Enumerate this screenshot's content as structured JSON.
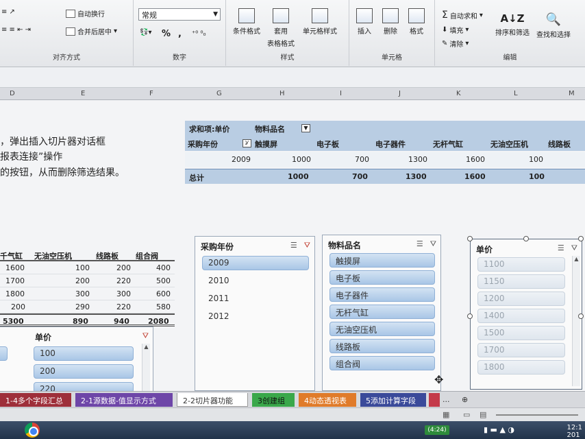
{
  "ribbon": {
    "alignment_group": {
      "label": "对齐方式",
      "wrap": "自动换行",
      "merge": "合并后居中"
    },
    "number_group": {
      "label": "数字",
      "format": "常规",
      "percent": "%",
      "comma": ","
    },
    "styles_group": {
      "label": "样式",
      "conditional": "条件格式",
      "table_format_1": "套用",
      "table_format_2": "表格格式",
      "cell_styles": "单元格样式"
    },
    "cells_group": {
      "label": "单元格",
      "insert": "插入",
      "delete": "删除",
      "format": "格式"
    },
    "editing_group": {
      "label": "编辑",
      "autosum": "自动求和",
      "fill": "填充",
      "clear": "清除",
      "sort": "排序和筛选",
      "find": "查找和选择"
    }
  },
  "columns": [
    "D",
    "E",
    "F",
    "G",
    "H",
    "I",
    "J",
    "K",
    "L",
    "M"
  ],
  "notes": [
    "，弹出插入切片器对话框",
    "报表连接”操作",
    "的按钮，从而删除筛选结果。"
  ],
  "pivot": {
    "header_left": "求和项:单价",
    "header_field": "物料品名",
    "row_field": "采购年份",
    "columns": [
      "触摸屏",
      "电子板",
      "电子器件",
      "无杆气缸",
      "无油空压机",
      "线路板"
    ],
    "year": "2009",
    "values": [
      "1000",
      "700",
      "1300",
      "1600",
      "100"
    ],
    "total_label": "总计",
    "totals": [
      "1000",
      "700",
      "1300",
      "1600",
      "100"
    ]
  },
  "left_table": {
    "headers": [
      "千气缸",
      "无油空压机",
      "线路板",
      "组合阀"
    ],
    "rows": [
      [
        "1600",
        "100",
        "200",
        "400"
      ],
      [
        "1700",
        "200",
        "220",
        "500"
      ],
      [
        "1800",
        "300",
        "300",
        "600"
      ],
      [
        "200",
        "290",
        "220",
        "580"
      ]
    ],
    "total": [
      "5300",
      "890",
      "940",
      "2080"
    ]
  },
  "slicer_year": {
    "title": "采购年份",
    "items": [
      "2009",
      "2010",
      "2011",
      "2012"
    ]
  },
  "slicer_material": {
    "title": "物料品名",
    "items": [
      "触摸屏",
      "电子板",
      "电子器件",
      "无杆气缸",
      "无油空压机",
      "线路板",
      "组合阀"
    ]
  },
  "slicer_price": {
    "title": "单价",
    "items": [
      "1100",
      "1150",
      "1200",
      "1400",
      "1500",
      "1700",
      "1800"
    ]
  },
  "slicer_price_small": {
    "title": "单价",
    "items": [
      "100",
      "200",
      "220"
    ]
  },
  "tabs": [
    {
      "label": "1-4多个字段汇总",
      "color": "#9e2f3a"
    },
    {
      "label": "2-1源数据-值显示方式",
      "color": "#6e46a8"
    },
    {
      "label": "2-2切片器功能",
      "color": "#ffffff"
    },
    {
      "label": "3创建组",
      "color": "#3aa84a"
    },
    {
      "label": "4动态透视表",
      "color": "#e07b2a"
    },
    {
      "label": "5添加计算字段",
      "color": "#3a4a9a"
    },
    {
      "label": "...",
      "color": "#d7d9dd"
    }
  ],
  "taskbar": {
    "battery": "(4:24)",
    "clock": "12:1",
    "date": "201"
  }
}
